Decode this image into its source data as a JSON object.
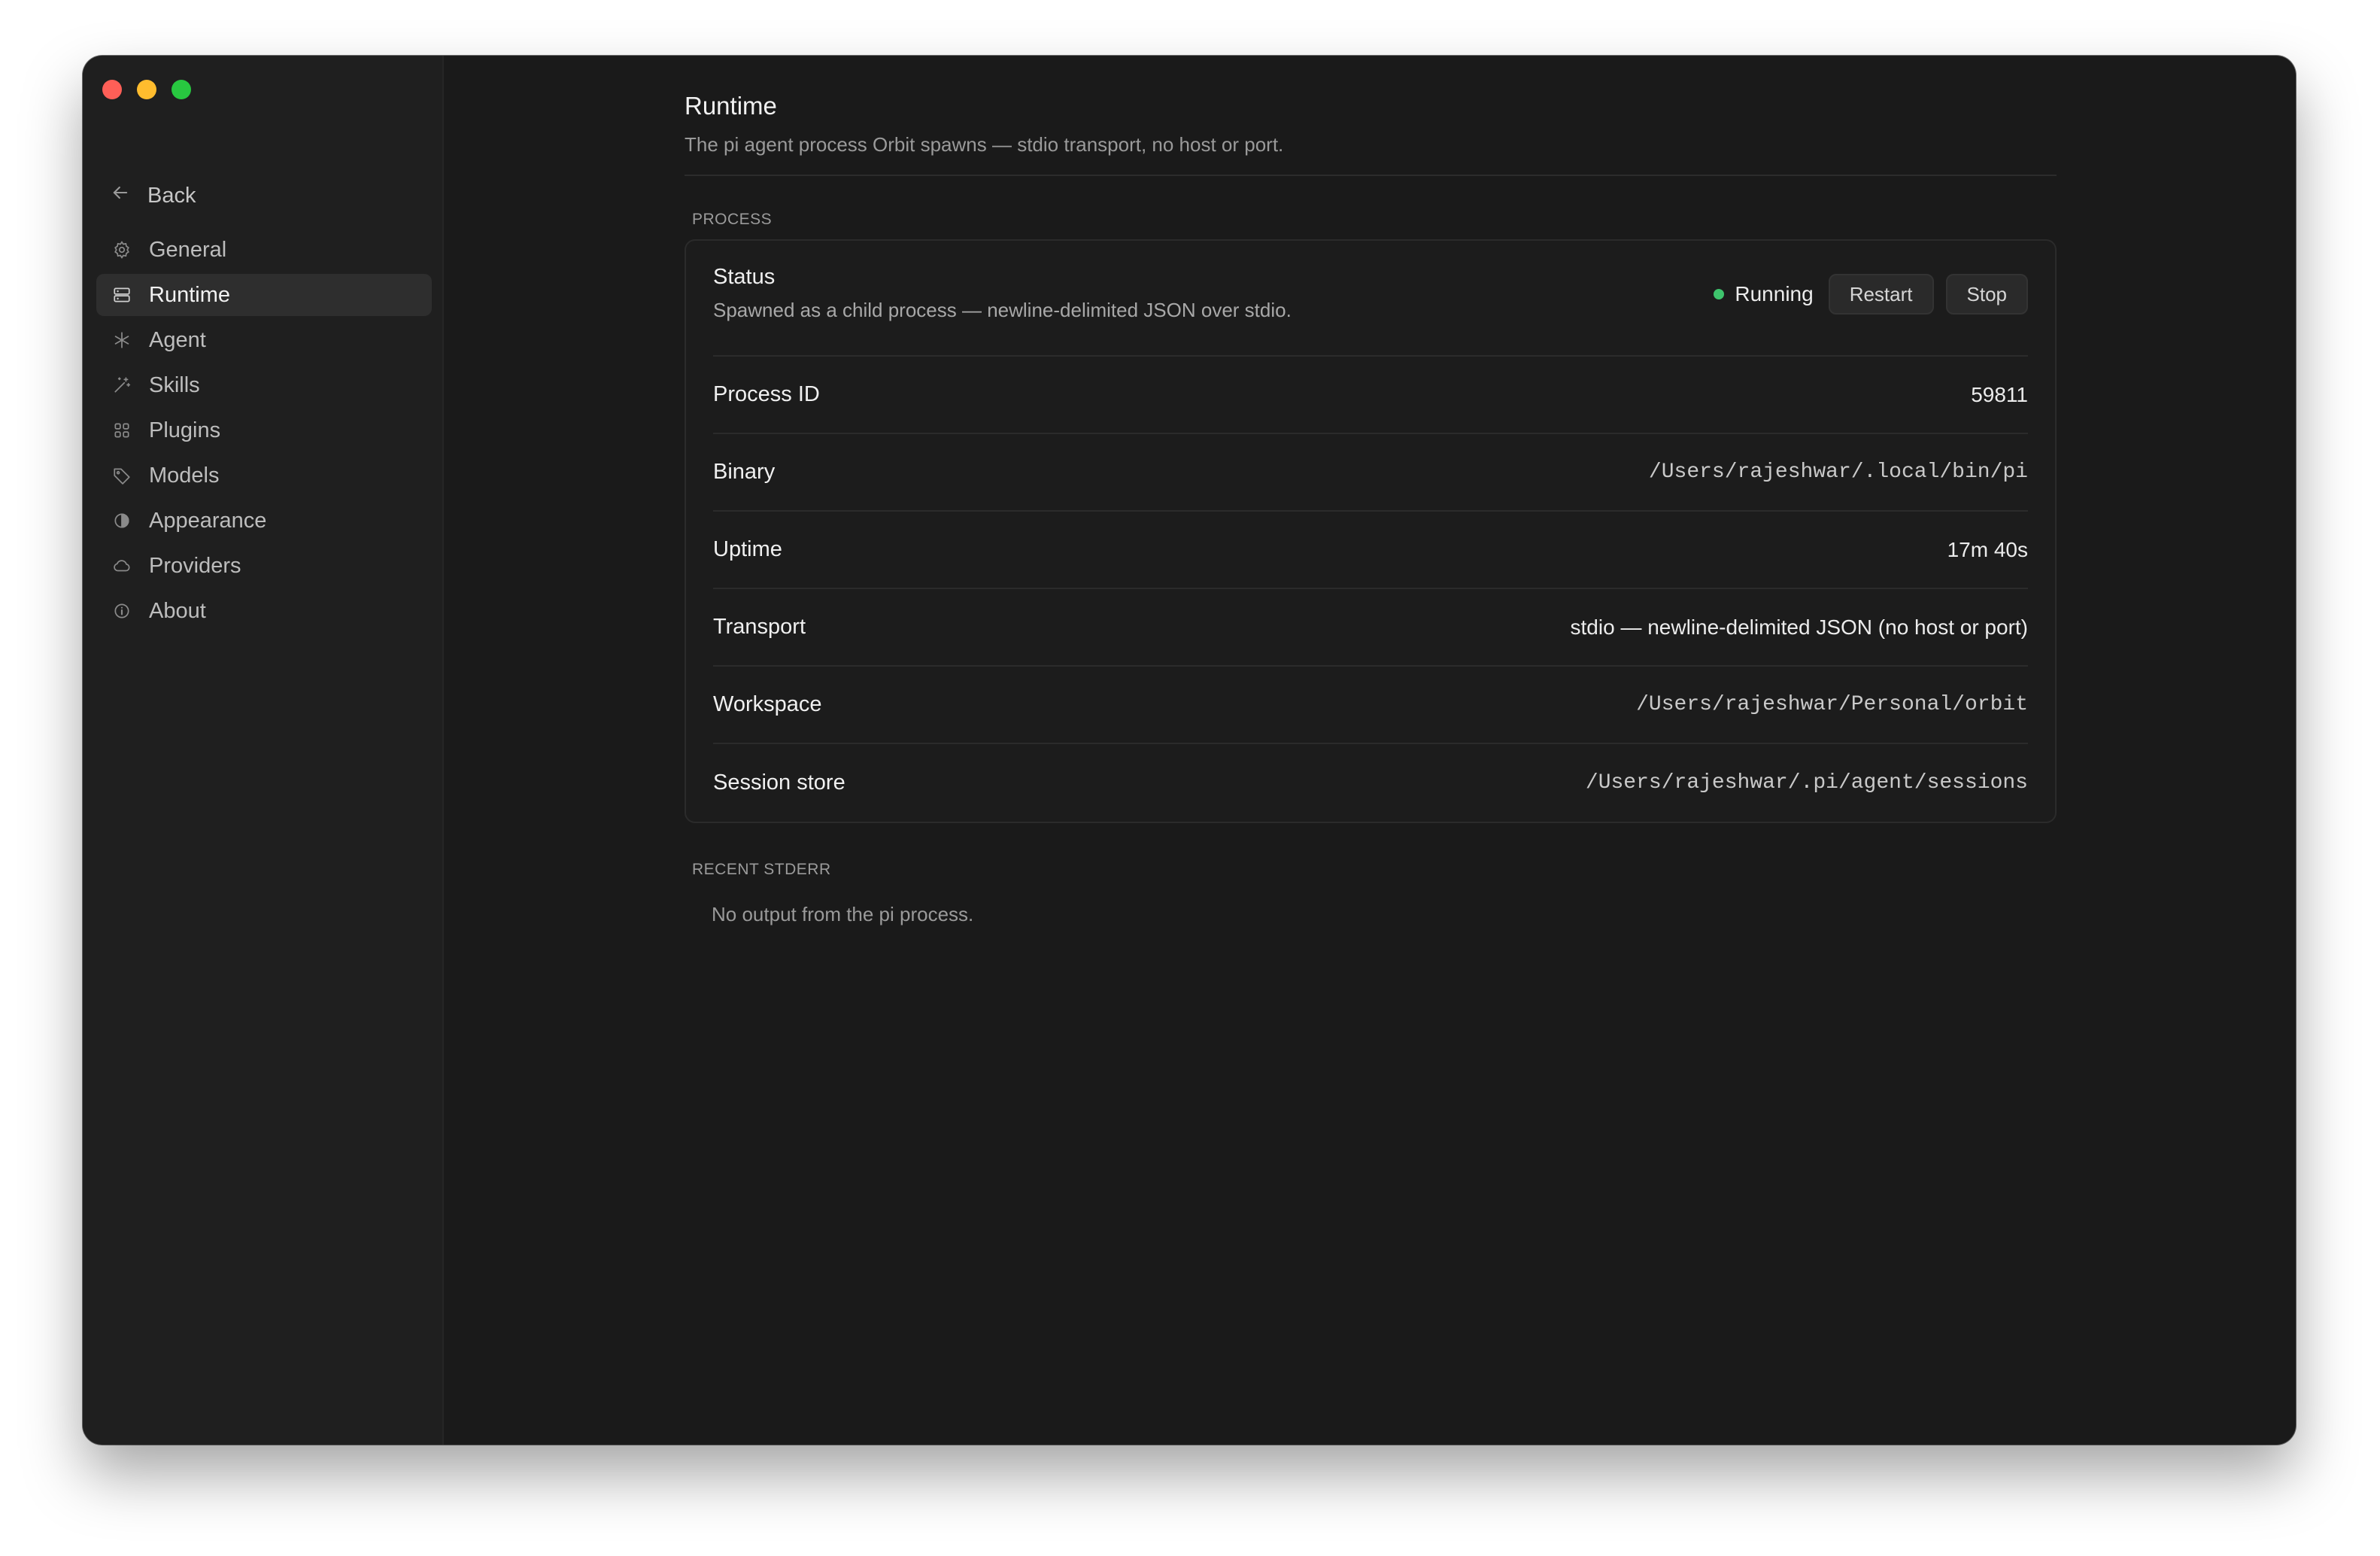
{
  "window": {
    "traffic_lights": [
      "close",
      "minimize",
      "maximize"
    ]
  },
  "sidebar": {
    "back_label": "Back",
    "back_icon": "arrow-left-icon",
    "items": [
      {
        "label": "General",
        "icon": "gear-icon",
        "active": false
      },
      {
        "label": "Runtime",
        "icon": "server-icon",
        "active": true
      },
      {
        "label": "Agent",
        "icon": "asterisk-icon",
        "active": false
      },
      {
        "label": "Skills",
        "icon": "wand-icon",
        "active": false
      },
      {
        "label": "Plugins",
        "icon": "grid-icon",
        "active": false
      },
      {
        "label": "Models",
        "icon": "tag-icon",
        "active": false
      },
      {
        "label": "Appearance",
        "icon": "contrast-icon",
        "active": false
      },
      {
        "label": "Providers",
        "icon": "cloud-icon",
        "active": false
      },
      {
        "label": "About",
        "icon": "info-icon",
        "active": false
      }
    ]
  },
  "page": {
    "title": "Runtime",
    "subtitle": "The pi agent process Orbit spawns — stdio transport, no host or port."
  },
  "process": {
    "section_label": "PROCESS",
    "status": {
      "label": "Status",
      "description": "Spawned as a child process — newline-delimited JSON over stdio.",
      "state": "Running",
      "state_color": "#3ec46d",
      "restart_label": "Restart",
      "stop_label": "Stop"
    },
    "rows": [
      {
        "label": "Process ID",
        "value": "59811",
        "mono": false
      },
      {
        "label": "Binary",
        "value": "/Users/rajeshwar/.local/bin/pi",
        "mono": true
      },
      {
        "label": "Uptime",
        "value": "17m 40s",
        "mono": false
      },
      {
        "label": "Transport",
        "value": "stdio — newline-delimited JSON (no host or port)",
        "mono": false
      },
      {
        "label": "Workspace",
        "value": "/Users/rajeshwar/Personal/orbit",
        "mono": true
      },
      {
        "label": "Session store",
        "value": "/Users/rajeshwar/.pi/agent/sessions",
        "mono": true
      }
    ]
  },
  "stderr": {
    "section_label": "RECENT STDERR",
    "empty_text": "No output from the pi process."
  }
}
